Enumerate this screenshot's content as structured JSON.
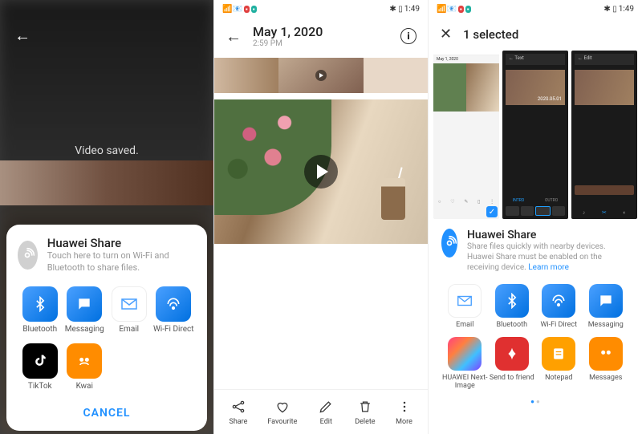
{
  "panel1": {
    "toast": "Video saved.",
    "huawei_share": {
      "title": "Huawei Share",
      "sub": "Touch here to turn on Wi-Fi and Bluetooth to share files."
    },
    "apps": [
      {
        "label": "Bluetooth"
      },
      {
        "label": "Messaging"
      },
      {
        "label": "Email"
      },
      {
        "label": "Wi-Fi Direct"
      },
      {
        "label": "TikTok"
      },
      {
        "label": "Kwai"
      }
    ],
    "cancel": "CANCEL"
  },
  "panel2": {
    "status_time": "1:49",
    "title": "May 1, 2020",
    "subtitle": "2:59 PM",
    "bottom": [
      {
        "label": "Share"
      },
      {
        "label": "Favourite"
      },
      {
        "label": "Edit"
      },
      {
        "label": "Delete"
      },
      {
        "label": "More"
      }
    ]
  },
  "panel3": {
    "status_time": "1:49",
    "title": "1 selected",
    "thumb1": {
      "date_title": "May 1, 2020",
      "tools": [
        "Share",
        "Favourite",
        "Edit",
        "Delete",
        "More"
      ]
    },
    "thumb2": {
      "btn": "← Text",
      "date_overlay": "2020.05.01",
      "tabs": [
        "INTRO",
        "OUTRO"
      ]
    },
    "thumb3": {
      "btn": "← Edit"
    },
    "huawei_share": {
      "title": "Huawei Share",
      "sub": "Share files quickly with nearby devices. Huawei Share must be enabled on the receiving device. ",
      "learn": "Learn more"
    },
    "apps": [
      {
        "label": "Email"
      },
      {
        "label": "Bluetooth"
      },
      {
        "label": "Wi-Fi Direct"
      },
      {
        "label": "Messaging"
      },
      {
        "label": "HUAWEI Next-Image"
      },
      {
        "label": "Send to friend"
      },
      {
        "label": "Notepad"
      },
      {
        "label": "Messages"
      }
    ]
  }
}
